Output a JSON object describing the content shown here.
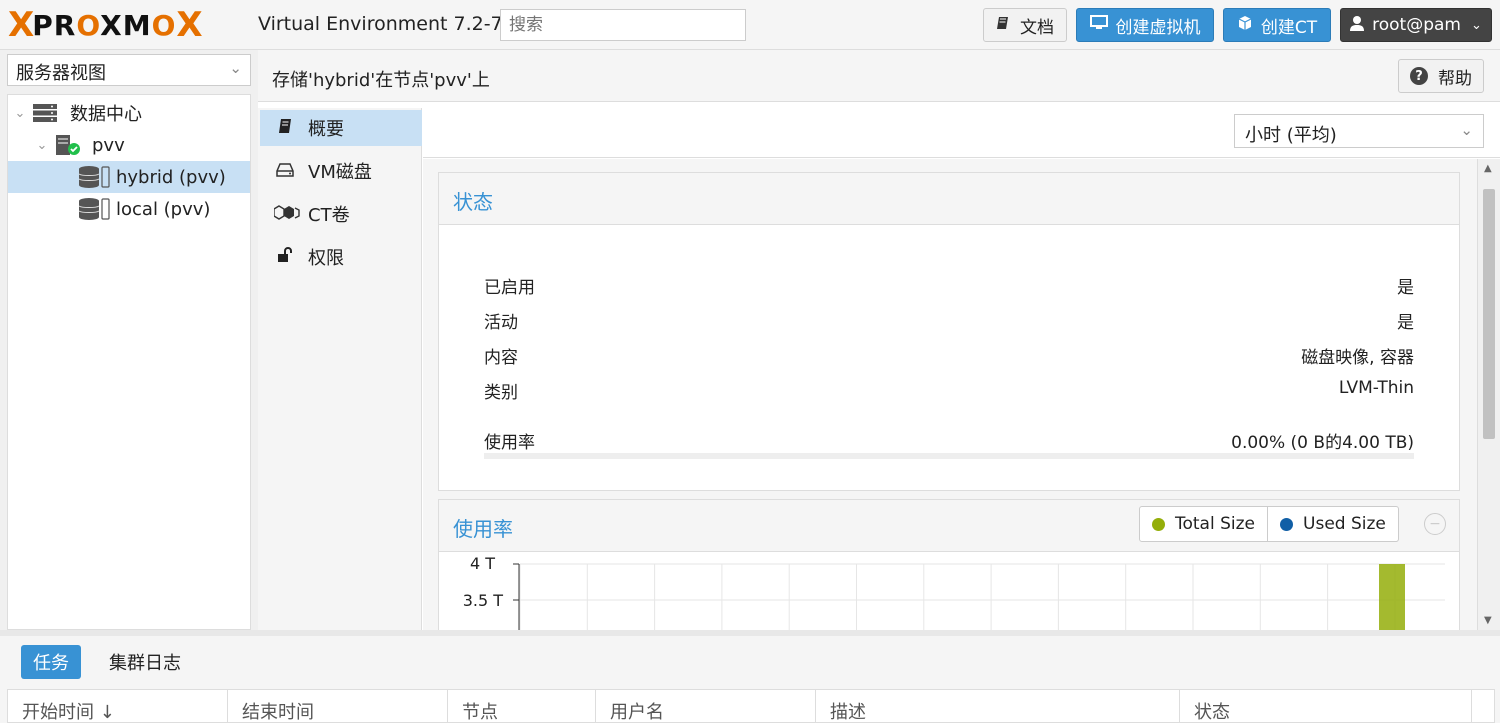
{
  "header": {
    "logo_x": "X",
    "logo_text_a": "PR",
    "logo_text_o1": "O",
    "logo_text_b": "XM",
    "logo_text_o2": "O",
    "logo_x2": "X",
    "version": "Virtual Environment 7.2-7",
    "search_placeholder": "搜索",
    "docs_label": "文档",
    "create_vm_label": "创建虚拟机",
    "create_ct_label": "创建CT",
    "user_label": "root@pam"
  },
  "sidebar": {
    "view_select": "服务器视图",
    "tree": [
      {
        "label": "数据中心",
        "icon": "datacenter-icon"
      },
      {
        "label": "pvv",
        "icon": "node-icon"
      },
      {
        "label": "hybrid (pvv)",
        "icon": "storage-icon",
        "selected": true
      },
      {
        "label": "local (pvv)",
        "icon": "storage-icon"
      }
    ]
  },
  "main": {
    "title": "存储'hybrid'在节点'pvv'上",
    "help_label": "帮助",
    "nav": [
      {
        "label": "概要",
        "icon": "book-icon",
        "selected": true
      },
      {
        "label": "VM磁盘",
        "icon": "hdd-icon"
      },
      {
        "label": "CT卷",
        "icon": "cubes-icon"
      },
      {
        "label": "权限",
        "icon": "unlock-icon"
      }
    ],
    "timeframe": "小时 (平均)"
  },
  "status": {
    "title": "状态",
    "rows": [
      {
        "key": "已启用",
        "value": "是"
      },
      {
        "key": "活动",
        "value": "是"
      },
      {
        "key": "内容",
        "value": "磁盘映像, 容器"
      },
      {
        "key": "类别",
        "value": "LVM-Thin"
      }
    ],
    "usage_key": "使用率",
    "usage_value": "0.00% (0 B的4.00 TB)",
    "usage_fraction": 0.0
  },
  "chart_data": {
    "type": "bar",
    "title": "使用率",
    "series": [
      {
        "name": "Total Size",
        "color": "#94ae0a"
      },
      {
        "name": "Used Size",
        "color": "#115fa6"
      }
    ],
    "y_ticks": [
      "4 T",
      "3.5 T"
    ],
    "ylim_visible": [
      3.5,
      4
    ],
    "total_size_last_value": 4
  },
  "bottom": {
    "tab_tasks": "任务",
    "tab_cluster_log": "集群日志",
    "columns": [
      "开始时间 ↓",
      "结束时间",
      "节点",
      "用户名",
      "描述",
      "状态"
    ]
  },
  "colors": {
    "accent": "#3892d4",
    "selection": "#c8e0f4",
    "logo_orange": "#e57000"
  }
}
